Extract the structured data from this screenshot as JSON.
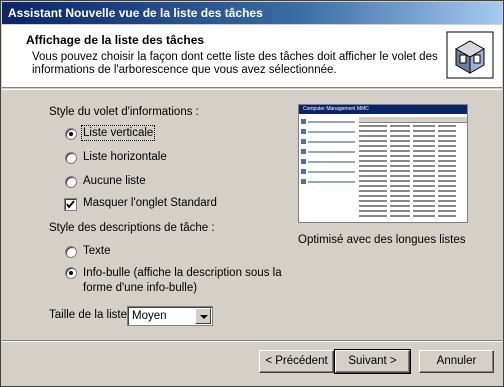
{
  "window": {
    "title": "Assistant Nouvelle vue de la liste des tâches"
  },
  "header": {
    "title": "Affichage de la liste des tâches",
    "description": "Vous pouvez choisir la façon dont cette liste des tâches doit afficher le volet des informations de l'arborescence que vous avez sélectionnée.",
    "icon": "wizard-page-icon"
  },
  "details_pane": {
    "label": "Style du volet d'informations :",
    "options": [
      {
        "label": "Liste verticale",
        "selected": true
      },
      {
        "label": "Liste horizontale",
        "selected": false
      },
      {
        "label": "Aucune liste",
        "selected": false
      }
    ],
    "hide_standard_tab": {
      "label": "Masquer l'onglet Standard",
      "checked": true
    }
  },
  "task_description": {
    "label": "Style des descriptions de tâche :",
    "options": [
      {
        "label": "Texte",
        "selected": false
      },
      {
        "label_line1": "Info-bulle (affiche la description sous la",
        "label_line2": "forme d'une info-bulle)",
        "selected": true
      }
    ]
  },
  "list_size": {
    "label": "Taille de la liste :",
    "value": "Moyen"
  },
  "preview": {
    "window_title": "Computer Management MMC",
    "caption": "Optimisé avec des longues listes"
  },
  "buttons": {
    "back": "< Précédent",
    "next": "Suivant >",
    "cancel": "Annuler"
  }
}
